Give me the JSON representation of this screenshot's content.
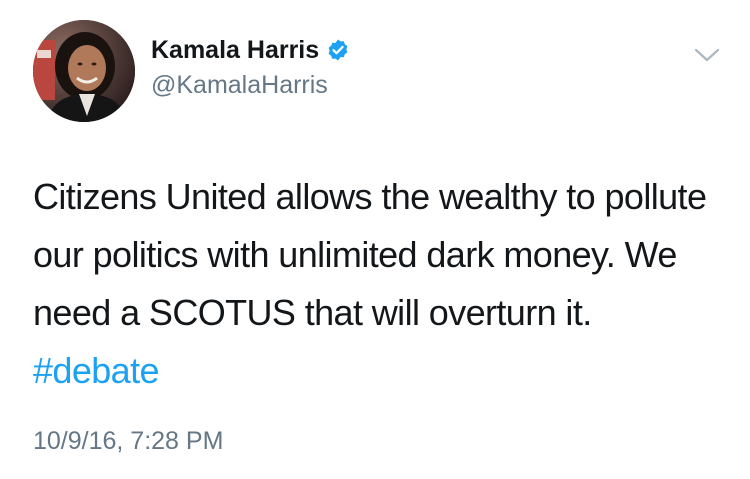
{
  "author": {
    "display_name": "Kamala Harris",
    "handle": "@KamalaHarris",
    "verified": true,
    "verified_badge_color": "#1da1f2"
  },
  "tweet": {
    "text": "Citizens United allows the wealthy to pollute our politics with unlimited dark money. We need a SCOTUS that will overturn it.",
    "hashtag": "#debate",
    "timestamp": "10/9/16, 7:28 PM"
  },
  "icons": {
    "verified": "verified-badge-icon",
    "menu": "chevron-down-icon"
  },
  "colors": {
    "text": "#14171a",
    "secondary_text": "#657786",
    "link": "#1da1f2",
    "background": "#ffffff"
  }
}
